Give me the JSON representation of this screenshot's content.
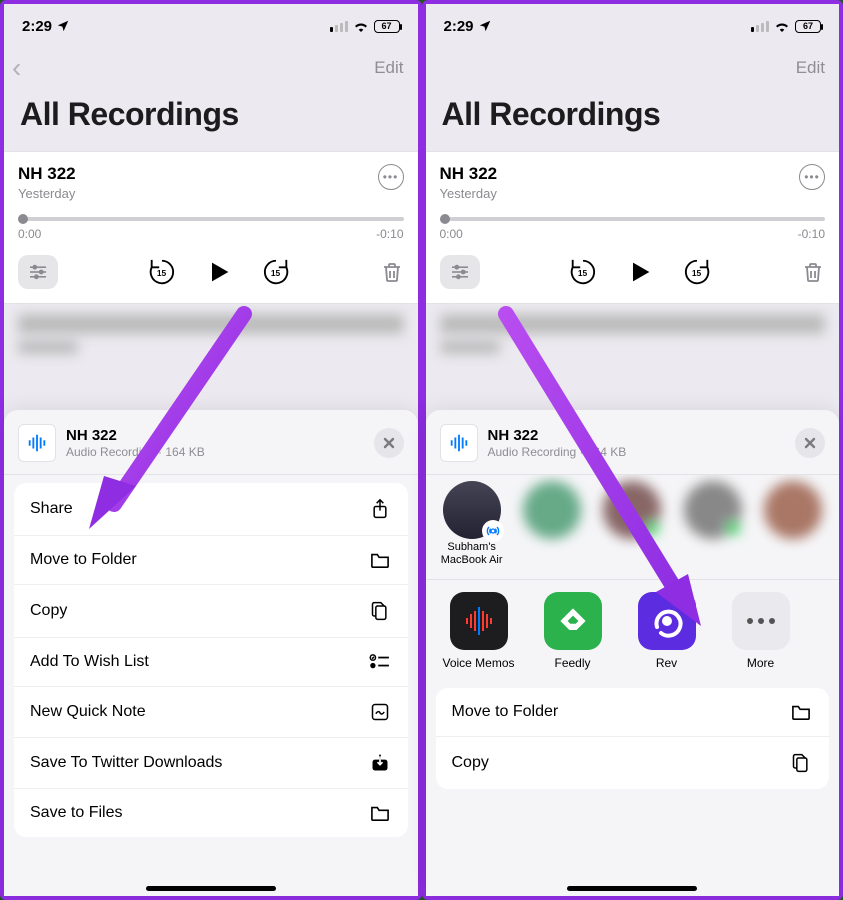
{
  "status": {
    "time": "2:29",
    "battery": "67"
  },
  "nav": {
    "edit": "Edit"
  },
  "page_title": "All Recordings",
  "recording": {
    "name": "NH 322",
    "subtitle": "Yesterday",
    "time_start": "0:00",
    "time_end": "-0:10"
  },
  "sheet": {
    "file_title": "NH 322",
    "file_sub": "Audio Recording · 164 KB"
  },
  "menuA": [
    {
      "label": "Share",
      "icon": "share"
    },
    {
      "label": "Move to Folder",
      "icon": "folder"
    },
    {
      "label": "Copy",
      "icon": "copy"
    },
    {
      "label": "Add To Wish List",
      "icon": "checklist"
    },
    {
      "label": "New Quick Note",
      "icon": "note"
    },
    {
      "label": "Save To Twitter Downloads",
      "icon": "download"
    },
    {
      "label": "Save to Files",
      "icon": "folder"
    }
  ],
  "airdrop": {
    "device_name": "Subham's MacBook Air"
  },
  "apps": [
    {
      "label": "Voice Memos"
    },
    {
      "label": "Feedly"
    },
    {
      "label": "Rev"
    },
    {
      "label": "More"
    }
  ],
  "menuB": [
    {
      "label": "Move to Folder",
      "icon": "folder"
    },
    {
      "label": "Copy",
      "icon": "copy"
    }
  ]
}
